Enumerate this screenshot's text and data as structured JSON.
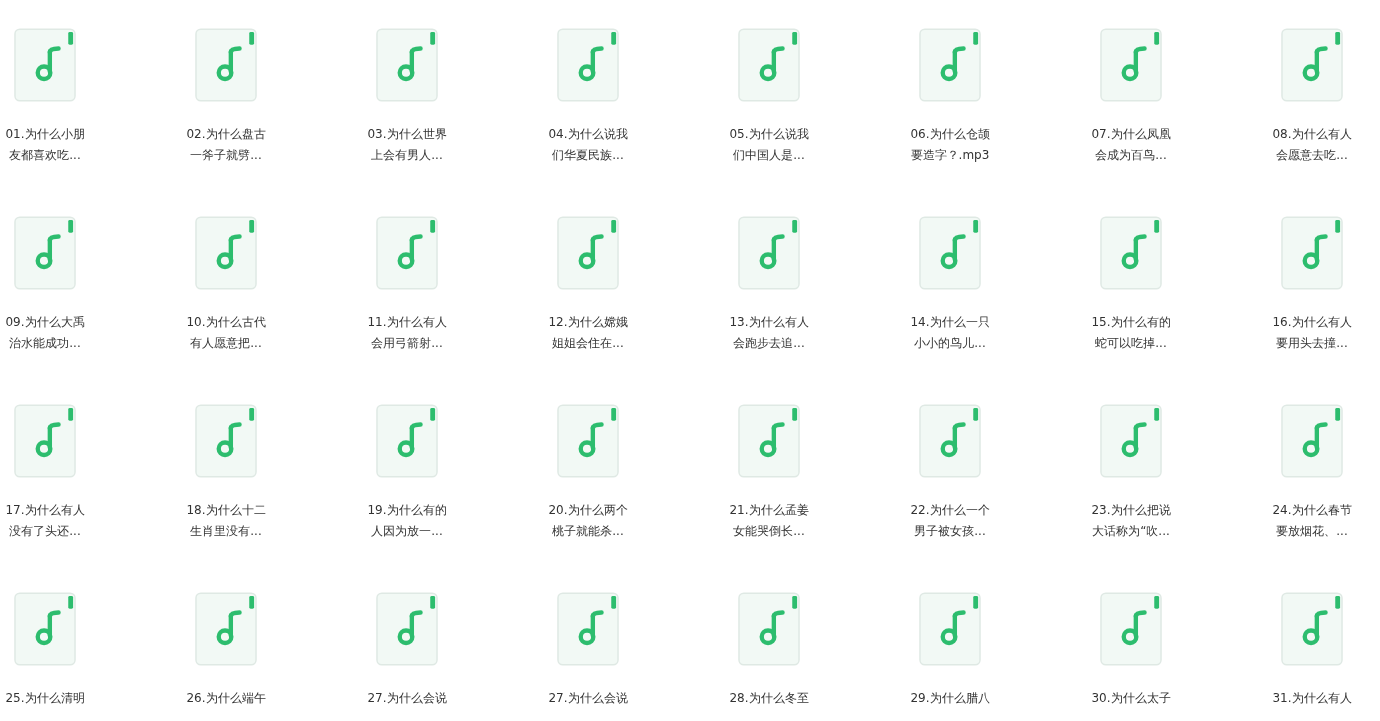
{
  "files": [
    {
      "lines": [
        "01.为什么小朋",
        "友都喜欢吃..."
      ]
    },
    {
      "lines": [
        "02.为什么盘古",
        "一斧子就劈..."
      ]
    },
    {
      "lines": [
        "03.为什么世界",
        "上会有男人..."
      ]
    },
    {
      "lines": [
        "04.为什么说我",
        "们华夏民族..."
      ]
    },
    {
      "lines": [
        "05.为什么说我",
        "们中国人是..."
      ]
    },
    {
      "lines": [
        "06.为什么仓颉",
        "要造字？.mp3"
      ]
    },
    {
      "lines": [
        "07.为什么凤凰",
        "会成为百鸟..."
      ]
    },
    {
      "lines": [
        "08.为什么有人",
        "会愿意去吃..."
      ]
    },
    {
      "lines": [
        "09.为什么大禹",
        "治水能成功..."
      ]
    },
    {
      "lines": [
        "10.为什么古代",
        "有人愿意把..."
      ]
    },
    {
      "lines": [
        "11.为什么有人",
        "会用弓箭射..."
      ]
    },
    {
      "lines": [
        "12.为什么嫦娥",
        "姐姐会住在..."
      ]
    },
    {
      "lines": [
        "13.为什么有人",
        "会跑步去追..."
      ]
    },
    {
      "lines": [
        "14.为什么一只",
        "小小的鸟儿..."
      ]
    },
    {
      "lines": [
        "15.为什么有的",
        "蛇可以吃掉..."
      ]
    },
    {
      "lines": [
        "16.为什么有人",
        "要用头去撞..."
      ]
    },
    {
      "lines": [
        "17.为什么有人",
        "没有了头还..."
      ]
    },
    {
      "lines": [
        "18.为什么十二",
        "生肖里没有..."
      ]
    },
    {
      "lines": [
        "19.为什么有的",
        "人因为放一..."
      ]
    },
    {
      "lines": [
        "20.为什么两个",
        "桃子就能杀..."
      ]
    },
    {
      "lines": [
        "21.为什么孟姜",
        "女能哭倒长..."
      ]
    },
    {
      "lines": [
        "22.为什么一个",
        "男子被女孩..."
      ]
    },
    {
      "lines": [
        "23.为什么把说",
        "大话称为“吹..."
      ]
    },
    {
      "lines": [
        "24.为什么春节",
        "要放烟花、..."
      ]
    },
    {
      "lines": [
        "25.为什么清明"
      ]
    },
    {
      "lines": [
        "26.为什么端午"
      ]
    },
    {
      "lines": [
        "27.为什么会说"
      ]
    },
    {
      "lines": [
        "27.为什么会说"
      ]
    },
    {
      "lines": [
        "28.为什么冬至"
      ]
    },
    {
      "lines": [
        "29.为什么腊八"
      ]
    },
    {
      "lines": [
        "30.为什么太子"
      ]
    },
    {
      "lines": [
        "31.为什么有人"
      ]
    }
  ]
}
